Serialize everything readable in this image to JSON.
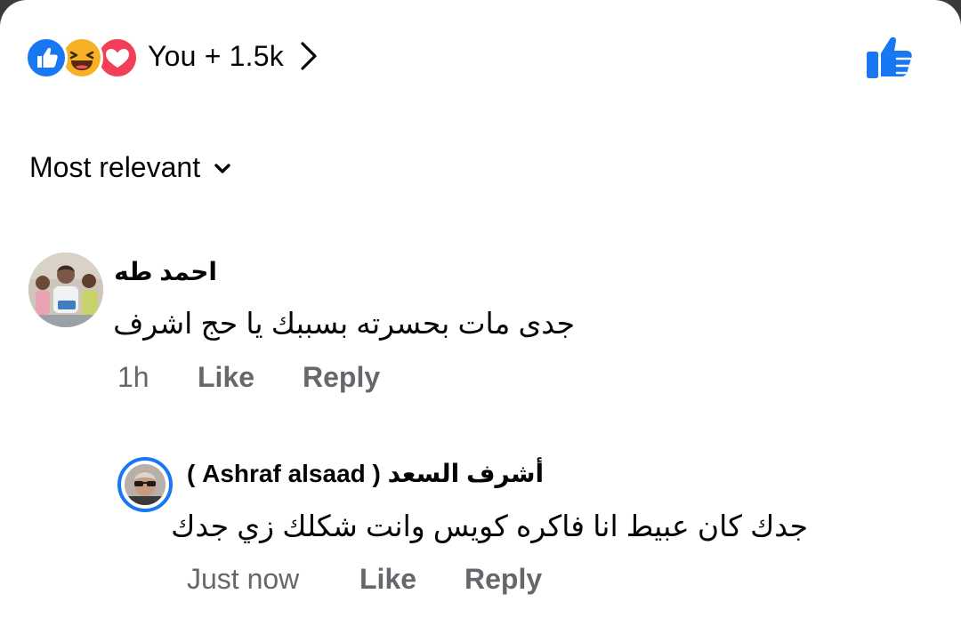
{
  "reactions": {
    "types": [
      "like-icon",
      "haha-icon",
      "love-icon"
    ],
    "summary": "You + 1.5k",
    "colors": {
      "like": "#1877f2",
      "haha": "#f7b125",
      "love": "#f33e58"
    }
  },
  "sort": {
    "label": "Most relevant"
  },
  "comments": [
    {
      "author": "احمد طه",
      "text": "جدى مات بحسرته بسببك يا حج اشرف",
      "time": "1h",
      "like_label": "Like",
      "reply_label": "Reply"
    },
    {
      "author": "أشرف السعد ( Ashraf alsaad )",
      "text": "جدك كان عبيط انا فاكره كويس وانت شكلك زي جدك",
      "time": "Just now",
      "like_label": "Like",
      "reply_label": "Reply"
    }
  ],
  "theme": {
    "accent": "#1877f2",
    "text_primary": "#050505",
    "text_secondary": "#65676b"
  }
}
